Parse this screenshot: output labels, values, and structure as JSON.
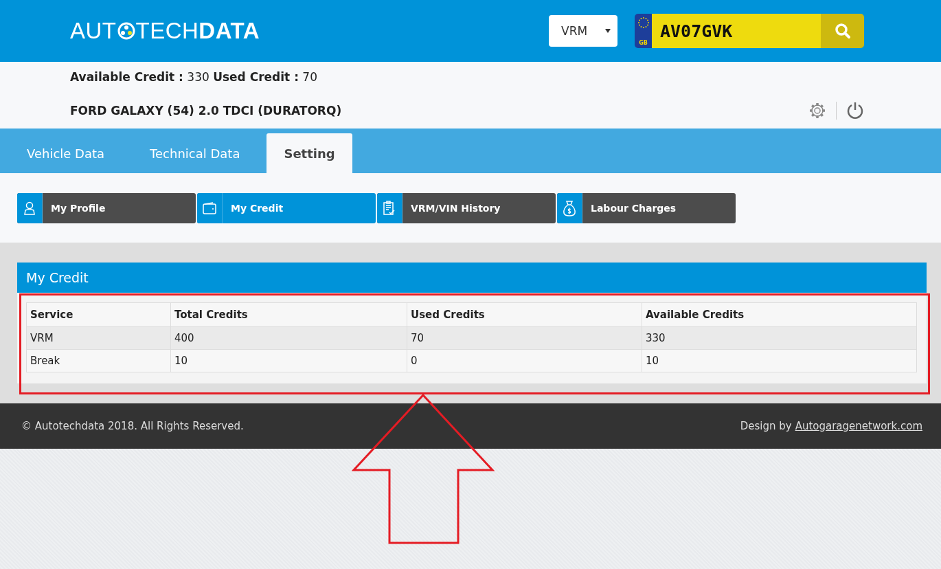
{
  "logo": {
    "start": "AUT",
    "middle": "TECH",
    "end": "DATA"
  },
  "search": {
    "type_value": "VRM",
    "plate_country": "GB",
    "plate_value": "AV07GVK"
  },
  "credit_summary": {
    "available_label": "Available Credit :",
    "available_value": "330",
    "used_label": "Used Credit :",
    "used_value": "70"
  },
  "vehicle_title": "FORD GALAXY (54) 2.0 TDCI (DURATORQ)",
  "tabs": [
    {
      "label": "Vehicle Data",
      "selected": false
    },
    {
      "label": "Technical Data",
      "selected": false
    },
    {
      "label": "Setting",
      "selected": true
    }
  ],
  "sub_nav": [
    {
      "kind": "profile",
      "label": "My Profile",
      "selected": false
    },
    {
      "kind": "wallet",
      "label": "My Credit",
      "selected": true
    },
    {
      "kind": "history",
      "label": "VRM/VIN History",
      "selected": false
    },
    {
      "kind": "money",
      "label": "Labour Charges",
      "selected": false
    }
  ],
  "panel": {
    "title": "My Credit",
    "table": {
      "columns": [
        "Service",
        "Total Credits",
        "Used Credits",
        "Available Credits"
      ],
      "rows": [
        [
          "VRM",
          "400",
          "70",
          "330"
        ],
        [
          "Break",
          "10",
          "0",
          "10"
        ]
      ]
    }
  },
  "footer": {
    "copyright": "© Autotechdata 2018. All Rights Reserved.",
    "design_label": "Design by",
    "design_link": "Autogaragenetwork.com"
  }
}
